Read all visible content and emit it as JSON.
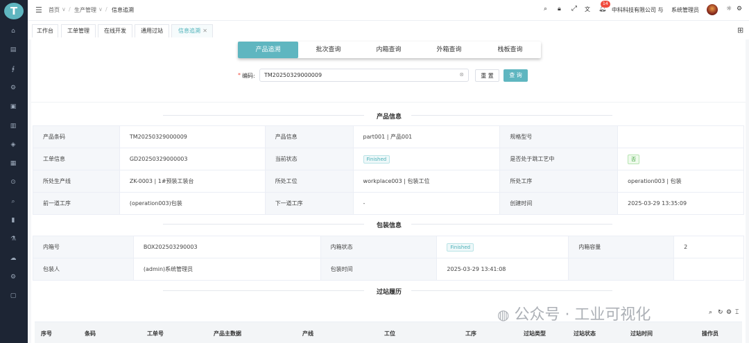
{
  "app": {
    "logo_letter": "T",
    "brand_color": "#5fb6c0"
  },
  "sidebar": {
    "icons": [
      "home-icon",
      "doc-icon",
      "chart-icon",
      "settings-gear-icon",
      "box-icon",
      "building-icon",
      "layers-icon",
      "database-icon",
      "location-icon",
      "search-icon",
      "bar-chart-icon",
      "lab-icon",
      "cloud-icon",
      "gear-icon",
      "tablet-icon"
    ]
  },
  "breadcrumb": {
    "items": [
      "首页",
      "生产管理",
      "信息追溯"
    ]
  },
  "header": {
    "notif_count": "14",
    "company": "中科科技有限公司 与",
    "user": "系统管理员"
  },
  "tabs": [
    {
      "label": "工作台"
    },
    {
      "label": "工单管理"
    },
    {
      "label": "在线开发"
    },
    {
      "label": "通用过站"
    },
    {
      "label": "信息追溯"
    }
  ],
  "query_tabs": [
    "产品追溯",
    "批次查询",
    "内箱查询",
    "外箱查询",
    "栈板查询"
  ],
  "search": {
    "label": "编码:",
    "required_mark": "*",
    "value": "TM20250329000009",
    "reset": "重 置",
    "query": "查 询"
  },
  "product_info": {
    "title": "产品信息",
    "rows": [
      [
        {
          "k": "产品条码",
          "v": "TM20250329000009"
        },
        {
          "k": "产品信息",
          "v": "part001 | 产品001"
        },
        {
          "k": "规格型号",
          "v": ""
        }
      ],
      [
        {
          "k": "工单信息",
          "v": "GD20250329000003"
        },
        {
          "k": "当前状态",
          "v": "Finished",
          "badge": true
        },
        {
          "k": "是否处于跳工艺中",
          "v": "否",
          "badge": "green"
        }
      ],
      [
        {
          "k": "所处生产线",
          "v": "ZK-0003 | 1#预装工装台"
        },
        {
          "k": "所处工位",
          "v": "workplace003 | 包装工位"
        },
        {
          "k": "所处工序",
          "v": "operation003 | 包装"
        }
      ],
      [
        {
          "k": "前一道工序",
          "v": "(operation003)包装"
        },
        {
          "k": "下一道工序",
          "v": "-"
        },
        {
          "k": "创建时间",
          "v": "2025-03-29 13:35:09"
        }
      ]
    ]
  },
  "package_info": {
    "title": "包装信息",
    "rows": [
      [
        {
          "k": "内箱号",
          "v": "BOX202503290003"
        },
        {
          "k": "内箱状态",
          "v": "Finished",
          "badge": true
        },
        {
          "k": "内箱容量",
          "v": "2"
        }
      ],
      [
        {
          "k": "包装人",
          "v": "(admin)系统管理员"
        },
        {
          "k": "包装时间",
          "v": "2025-03-29 13:41:08"
        }
      ]
    ]
  },
  "history": {
    "title": "过站履历",
    "columns": [
      "序号",
      "条码",
      "工单号",
      "产品主数据",
      "产线",
      "工位",
      "工序",
      "过站类型",
      "过站状态",
      "过站时间",
      "操作员"
    ]
  },
  "watermark": "公众号 · 工业可视化"
}
